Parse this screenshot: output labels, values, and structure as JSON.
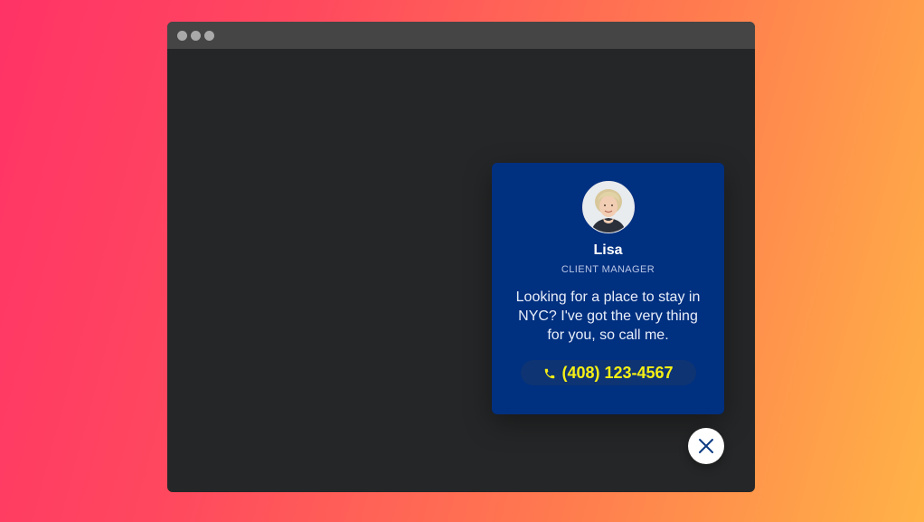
{
  "browser": {
    "buttons": [
      "close",
      "minimize",
      "maximize"
    ]
  },
  "widget": {
    "avatar_icon": "avatar-photo",
    "name": "Lisa",
    "role": "CLIENT MANAGER",
    "message": "Looking for a place to stay in NYC? I've got the very thing for you, so call me.",
    "phone_icon": "phone-icon",
    "phone": "(408) 123-4567",
    "close_icon": "close-icon"
  },
  "colors": {
    "card_background": "#003080",
    "phone_text": "#f6ef15",
    "window_background": "#252627",
    "titlebar": "#454545"
  }
}
